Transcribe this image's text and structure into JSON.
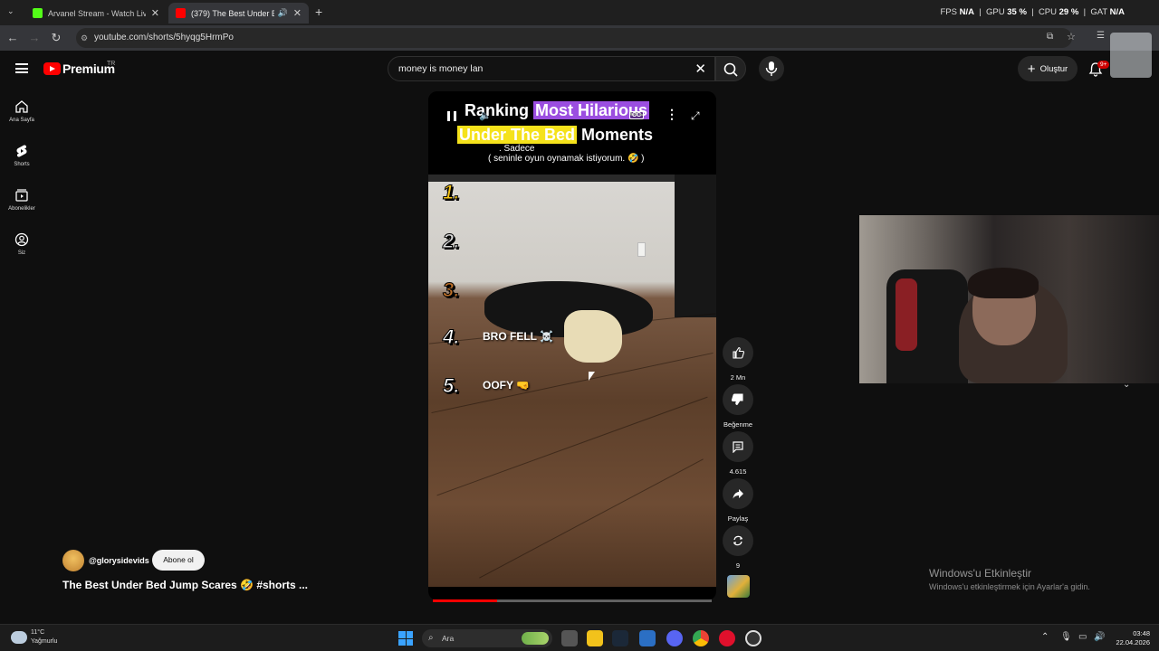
{
  "browser": {
    "tabs": [
      {
        "title": "Arvanel Stream - Watch Live on",
        "icon_color": "#53fc18",
        "active": false
      },
      {
        "title": "(379) The Best Under Bed Ju",
        "icon_color": "#ff0000",
        "active": true
      }
    ],
    "new_tab": "+",
    "url": "youtube.com/shorts/5hyqg5HrmPo",
    "stats": {
      "fps_label": "FPS",
      "fps": "N/A",
      "gpu_label": "GPU",
      "gpu": "35 %",
      "cpu_label": "CPU",
      "cpu": "29 %",
      "gat_label": "GAT",
      "gat": "N/A"
    }
  },
  "youtube": {
    "logo": "Premium",
    "region": "TR",
    "search_query": "money is money lan",
    "create_label": "Oluştur",
    "notifications": "9+",
    "sidebar": [
      {
        "label": "Ana Sayfa",
        "icon": "home-icon"
      },
      {
        "label": "Shorts",
        "icon": "shorts-icon"
      },
      {
        "label": "Abonelikler",
        "icon": "subscriptions-icon"
      },
      {
        "label": "Siz",
        "icon": "you-icon"
      }
    ]
  },
  "short": {
    "title_line1_a": "Ranking ",
    "title_line1_b": "Most Hilarious",
    "title_line2_a": "Under The Bed",
    "title_line2_b": " Moments",
    "subtitle1": ". Sadece",
    "subtitle2": "( seninle oyun oynamak istiyorum. 🤣 )",
    "cc": "CC",
    "ranks": [
      {
        "num": "1.",
        "color": "#f5c518",
        "label": ""
      },
      {
        "num": "2.",
        "color": "#d9d9d9",
        "label": ""
      },
      {
        "num": "3.",
        "color": "#c0722a",
        "label": ""
      },
      {
        "num": "4.",
        "color": "#ffffff",
        "label": "BRO FELL ☠️"
      },
      {
        "num": "5.",
        "color": "#ffffff",
        "label": "OOFY 🤜"
      }
    ],
    "progress": 0.23,
    "actions": {
      "likes": "2 Mn",
      "dislike_label": "Beğenme",
      "comments": "4.615",
      "share_label": "Paylaş",
      "remix_count": "9"
    },
    "channel": "@glorysidevids",
    "subscribe_label": "Abone ol",
    "video_title": "The Best Under Bed Jump Scares 🤣 #shorts ..."
  },
  "windows": {
    "watermark_title": "Windows'u Etkinleştir",
    "watermark_sub": "Windows'u etkinleştirmek için Ayarlar'a gidin.",
    "weather_temp": "11°C",
    "weather_desc": "Yağmurlu",
    "search_placeholder": "Ara",
    "time": "03:48",
    "date": "22.04.2026"
  }
}
